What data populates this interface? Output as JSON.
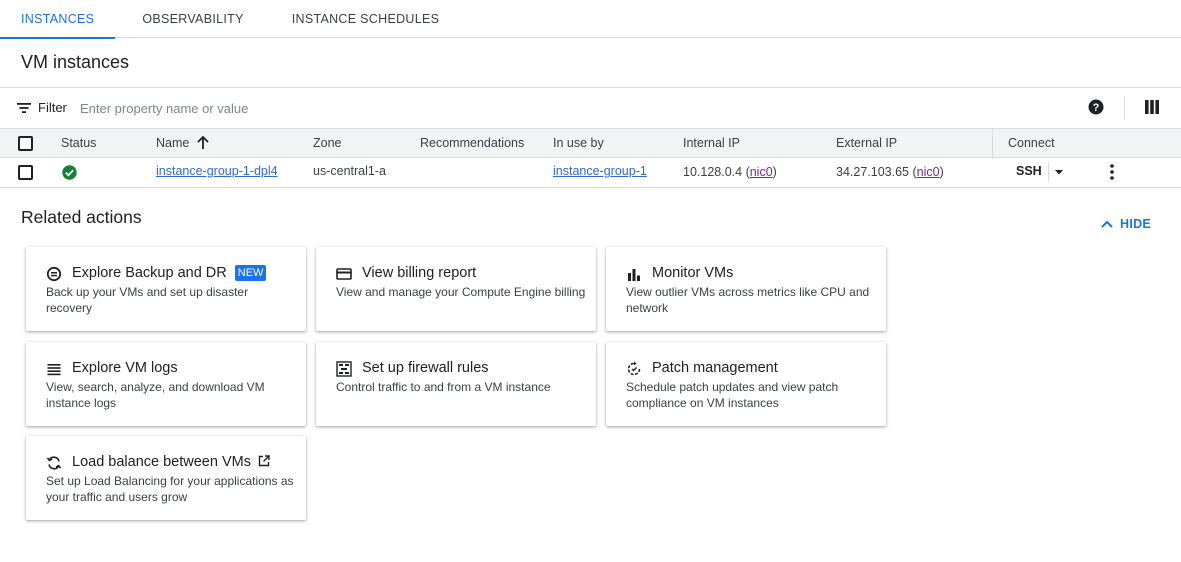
{
  "tabs": [
    {
      "label": "INSTANCES",
      "active": true
    },
    {
      "label": "OBSERVABILITY",
      "active": false
    },
    {
      "label": "INSTANCE SCHEDULES",
      "active": false
    }
  ],
  "page_title": "VM instances",
  "filter": {
    "label": "Filter",
    "placeholder": "Enter property name or value"
  },
  "table": {
    "headers": {
      "status": "Status",
      "name": "Name",
      "zone": "Zone",
      "recommendations": "Recommendations",
      "in_use_by": "In use by",
      "internal_ip": "Internal IP",
      "external_ip": "External IP",
      "connect": "Connect"
    },
    "rows": [
      {
        "status": "running",
        "name": "instance-group-1-dpl4",
        "zone": "us-central1-a",
        "recommendations": "",
        "in_use_by": "instance-group-1",
        "internal_ip": "10.128.0.4",
        "internal_nic": "nic0",
        "external_ip": "34.27.103.65",
        "external_nic": "nic0",
        "connect": "SSH"
      }
    ]
  },
  "related": {
    "title": "Related actions",
    "hide_label": "HIDE",
    "cards": [
      {
        "icon": "backup-icon",
        "title": "Explore Backup and DR",
        "badge": "NEW",
        "desc": "Back up your VMs and set up disaster recovery"
      },
      {
        "icon": "billing-card-icon",
        "title": "View billing report",
        "desc": "View and manage your Compute Engine billing"
      },
      {
        "icon": "bar-chart-icon",
        "title": "Monitor VMs",
        "desc": "View outlier VMs across metrics like CPU and network"
      },
      {
        "icon": "logs-list-icon",
        "title": "Explore VM logs",
        "desc": "View, search, analyze, and download VM instance logs"
      },
      {
        "icon": "firewall-icon",
        "title": "Set up firewall rules",
        "desc": "Control traffic to and from a VM instance"
      },
      {
        "icon": "patch-icon",
        "title": "Patch management",
        "desc": "Schedule patch updates and view patch compliance on VM instances"
      },
      {
        "icon": "load-balance-icon",
        "title": "Load balance between VMs",
        "desc": "Set up Load Balancing for your applications as your traffic and users grow"
      }
    ]
  },
  "colors": {
    "accent": "#1a73e8",
    "success": "#188038",
    "header_bg": "#f1f3f4"
  }
}
